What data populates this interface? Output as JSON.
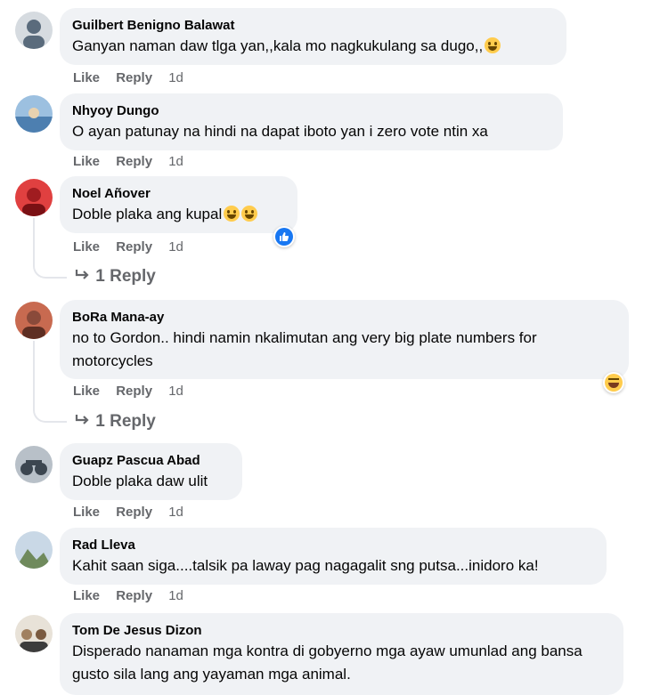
{
  "actions": {
    "like": "Like",
    "reply": "Reply"
  },
  "comments": [
    {
      "author": "Guilbert Benigno Balawat",
      "text": "Ganyan naman daw tlga yan,,kala mo nagkukulang sa dugo,,",
      "time": "1d",
      "emoji": "grinning-face-with-sweat",
      "avatar_color": "#5a6b7c"
    },
    {
      "author": "Nhyoy Dungo",
      "text": "O ayan patunay na hindi na dapat iboto yan i zero vote ntin xa",
      "time": "1d",
      "avatar_color": "#4d7fb0"
    },
    {
      "author": "Noel Añover",
      "text": "Doble plaka ang kupal",
      "time": "1d",
      "emoji": "rolling-on-floor-laughing",
      "reaction": "like",
      "replies": "1 Reply",
      "avatar_color": "#c0282d"
    },
    {
      "author": "BoRa Mana-ay",
      "text": "no to Gordon.. hindi namin nkalimutan ang very big plate numbers for motorcycles",
      "time": "1d",
      "reaction": "haha",
      "replies": "1 Reply",
      "avatar_color": "#8a4a3a"
    },
    {
      "author": "Guapz Pascua Abad",
      "text": "Doble plaka daw ulit",
      "time": "1d",
      "avatar_color": "#3c4650"
    },
    {
      "author": "Rad Lleva",
      "text": "Kahit saan siga....talsik pa laway pag nagagalit sng putsa...inidoro ka!",
      "time": "1d",
      "avatar_color": "#6f8a5c"
    },
    {
      "author": "Tom De Jesus Dizon",
      "text": "Disperado nanaman mga kontra di gobyerno mga ayaw umunlad ang bansa gusto sila lang ang yayaman mga animal.",
      "time": "",
      "avatar_color": "#a08060"
    }
  ],
  "colors": {
    "bubble": "#f0f2f5",
    "meta": "#65676b",
    "like_blue": "#1877f2"
  }
}
